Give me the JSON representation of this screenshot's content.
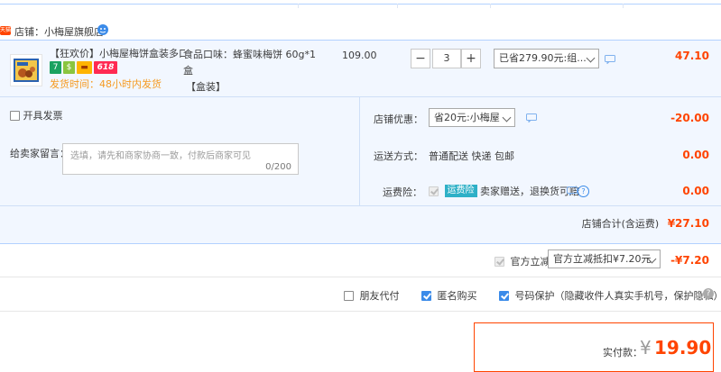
{
  "shop": {
    "badge": "天猫",
    "label": "店铺：小梅屋旗舰店"
  },
  "item": {
    "title": "【狂欢价】小梅屋梅饼盒装多口...",
    "badges": [
      "7",
      "$",
      "▬",
      "618"
    ],
    "ship_time": "发货时间：48小时内发货",
    "attrs_line1": "食品口味：蜂蜜味梅饼 60g*1盒",
    "attrs_line2": "【盒装】",
    "price": "109.00",
    "qty": "3",
    "qty_minus": "−",
    "qty_plus": "+",
    "promo": "已省279.90元:组...",
    "total": "47.10"
  },
  "invoice": {
    "label": "开具发票"
  },
  "memo": {
    "label": "给卖家留言：",
    "placeholder": "选填，请先和商家协商一致，付款后商家可见",
    "count": "0/200"
  },
  "shop_discount": {
    "label": "店铺优惠：",
    "selected": "省20元:小梅屋",
    "amount": "-20.00"
  },
  "delivery": {
    "label": "运送方式：",
    "value": "普通配送 快递 包邮",
    "amount": "0.00"
  },
  "shipping_insurance": {
    "label": "运费险：",
    "tag": "运费险",
    "text": "卖家赠送，退换货可赔",
    "amount": "0.00"
  },
  "shop_total": {
    "label": "店铺合计(含运费)",
    "amount": "¥27.10"
  },
  "official": {
    "label": "官方立减",
    "selected": "官方立减抵扣¥7.20元",
    "amount": "-¥7.20"
  },
  "options": {
    "friend_pay": "朋友代付",
    "anonymous": "匿名购买",
    "number_protect": "号码保护（隐藏收件人真实手机号，保护隐私）"
  },
  "payment": {
    "label": "实付款：",
    "currency": "¥",
    "amount": "19.90"
  },
  "colors": {
    "accent": "#ff4400",
    "border_blue": "#b2d1ff",
    "bg_blue": "#f2f7ff",
    "link_blue": "#3b8be9"
  }
}
